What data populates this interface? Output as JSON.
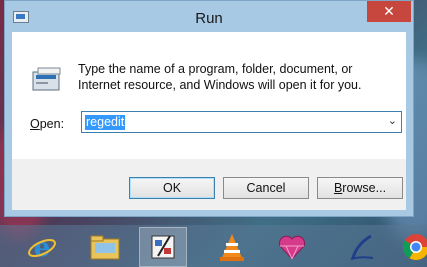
{
  "window": {
    "title": "Run",
    "close_glyph": "✕",
    "icon": "run-app-icon"
  },
  "dialog": {
    "description": "Type the name of a program, folder, document, or Internet resource, and Windows will open it for you.",
    "open_label": "Open:",
    "open_value": "regedit",
    "dropdown_glyph": "⌄"
  },
  "buttons": {
    "ok": "OK",
    "cancel": "Cancel",
    "browse": "Browse..."
  },
  "taskbar": {
    "items": [
      {
        "icon": "internet-explorer-icon"
      },
      {
        "icon": "file-explorer-icon"
      },
      {
        "icon": "registry-editor-icon"
      },
      {
        "icon": "vlc-icon"
      },
      {
        "icon": "pink-heart-app-icon"
      },
      {
        "icon": "pen-tool-app-icon"
      },
      {
        "icon": "chrome-icon"
      }
    ]
  }
}
